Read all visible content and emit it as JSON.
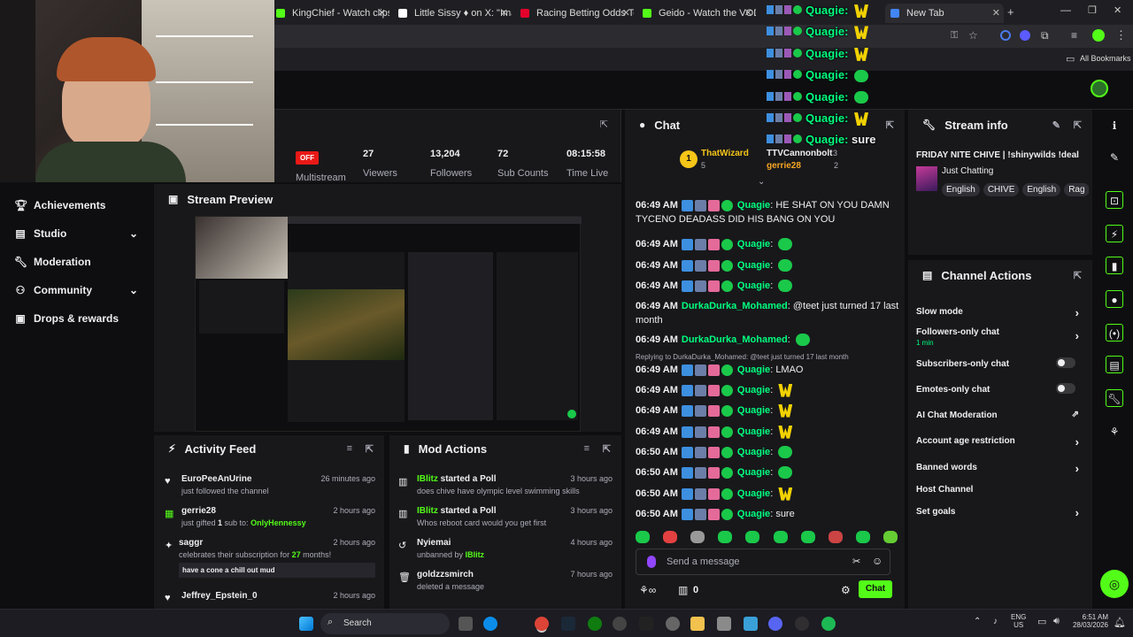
{
  "browser": {
    "tabs": [
      {
        "title": "KingChief - Watch clips o",
        "color": "#53fc18"
      },
      {
        "title": "Little Sissy ♦ on X: \"Imag",
        "color": "#ffffff"
      },
      {
        "title": "Racing Betting Odds Toda",
        "color": "#e4002b"
      },
      {
        "title": "Geido - Watch the VOD o",
        "color": "#53fc18"
      },
      {
        "title": "New Tab",
        "color": "#4285f4"
      }
    ],
    "bookmarks_label": "All Bookmarks"
  },
  "sidebar": {
    "items": [
      {
        "label": "Achievements",
        "icon": "trophy-icon",
        "chevron": false
      },
      {
        "label": "Studio",
        "icon": "studio-icon",
        "chevron": true
      },
      {
        "label": "Moderation",
        "icon": "wrench-icon",
        "chevron": false
      },
      {
        "label": "Community",
        "icon": "community-icon",
        "chevron": true
      },
      {
        "label": "Drops & rewards",
        "icon": "gift-icon",
        "chevron": false
      }
    ]
  },
  "stats": {
    "multistream_badge": "OFF",
    "multistream_label": "Multistream",
    "viewers": "27",
    "viewers_label": "Viewers",
    "followers": "13,204",
    "followers_label": "Followers",
    "subs": "72",
    "subs_label": "Sub Counts",
    "time_live": "08:15:58",
    "time_live_label": "Time Live"
  },
  "preview": {
    "title": "Stream Preview"
  },
  "activity": {
    "title": "Activity Feed",
    "items": [
      {
        "icon": "heart-icon",
        "name": "EuroPeeAnUrine",
        "text": "just followed the channel",
        "time": "26 minutes ago"
      },
      {
        "icon": "gift-icon",
        "name": "gerrie28",
        "text_pre": "just gifted ",
        "count": "1",
        "text_mid": " sub to: ",
        "target": "OnlyHennessy",
        "time": "2 hours ago"
      },
      {
        "icon": "star-icon",
        "name": "saggr",
        "text_pre": "celebrates their subscription for ",
        "count": "27",
        "text_mid": " months!",
        "quote": "have a cone a chill out mud",
        "time": "2 hours ago"
      },
      {
        "icon": "heart-icon",
        "name": "Jeffrey_Epstein_0",
        "text": "",
        "time": "2 hours ago"
      }
    ]
  },
  "modactions": {
    "title": "Mod Actions",
    "items": [
      {
        "icon": "poll-icon",
        "user": "IBlitz",
        "action": " started a Poll",
        "detail": "does chive have olympic level swimming skills",
        "time": "3 hours ago"
      },
      {
        "icon": "poll-icon",
        "user": "IBlitz",
        "action": " started a Poll",
        "detail": "Whos reboot card would you get first",
        "time": "3 hours ago"
      },
      {
        "icon": "unban-icon",
        "user": "Nyiemai",
        "action": "",
        "detail_pre": "unbanned by ",
        "detail_user": "IBlitz",
        "time": "4 hours ago"
      },
      {
        "icon": "trash-icon",
        "user": "goldzzsmirch",
        "action": "",
        "detail": "deleted a message",
        "time": "7 hours ago"
      }
    ]
  },
  "chat": {
    "title": "Chat",
    "leaderboard": [
      {
        "rank": "1",
        "name": "ThatWizard",
        "count": "5"
      },
      {
        "rank": "",
        "name": "TTVCannonbolt",
        "count": "3"
      },
      {
        "rank": "",
        "name": "gerrie28",
        "count": "2"
      }
    ],
    "messages": [
      {
        "time": "",
        "user": "Quagie",
        "text": "HE SHAT ON YOU DAMN TYCENO DEADASS DID HIS BANG ON YOU",
        "badges": true,
        "emote": ""
      },
      {
        "time": "06:49 AM",
        "user": "Quagie",
        "text": "",
        "badges": true,
        "emote": "green"
      },
      {
        "time": "06:49 AM",
        "user": "Quagie",
        "text": "",
        "badges": true,
        "emote": "green"
      },
      {
        "time": "06:49 AM",
        "user": "Quagie",
        "text": "",
        "badges": true,
        "emote": "green"
      },
      {
        "time": "06:49 AM",
        "user": "DurkaDurka_Mohamed",
        "text": "@teet just turned 17 last month",
        "badges": false,
        "emote": ""
      },
      {
        "time": "06:49 AM",
        "user": "DurkaDurka_Mohamed",
        "text": "",
        "badges": false,
        "emote": "green"
      },
      {
        "time": "06:49 AM",
        "user": "Quagie",
        "text": "LMAO",
        "badges": true,
        "emote": "",
        "reply": "Replying to DurkaDurka_Mohamed: @teet just turned 17 last month"
      },
      {
        "time": "06:49 AM",
        "user": "Quagie",
        "text": "",
        "badges": true,
        "emote": "W"
      },
      {
        "time": "06:49 AM",
        "user": "Quagie",
        "text": "",
        "badges": true,
        "emote": "W"
      },
      {
        "time": "06:49 AM",
        "user": "Quagie",
        "text": "",
        "badges": true,
        "emote": "W"
      },
      {
        "time": "06:50 AM",
        "user": "Quagie",
        "text": "",
        "badges": true,
        "emote": "green"
      },
      {
        "time": "06:50 AM",
        "user": "Quagie",
        "text": "",
        "badges": true,
        "emote": "green"
      },
      {
        "time": "06:50 AM",
        "user": "Quagie",
        "text": "",
        "badges": true,
        "emote": "W"
      },
      {
        "time": "06:50 AM",
        "user": "Quagie",
        "text": "sure",
        "badges": true,
        "emote": ""
      }
    ],
    "first_time": "06:49 AM",
    "input_placeholder": "Send a message",
    "points": "0",
    "send_label": "Chat"
  },
  "overlay": [
    {
      "user": "Quagie",
      "text": "",
      "emote": "W"
    },
    {
      "user": "Quagie",
      "text": "",
      "emote": "W"
    },
    {
      "user": "Quagie",
      "text": "",
      "emote": "W"
    },
    {
      "user": "Quagie",
      "text": "",
      "emote": "green"
    },
    {
      "user": "Quagie",
      "text": "",
      "emote": "green"
    },
    {
      "user": "Quagie",
      "text": "",
      "emote": "W"
    },
    {
      "user": "Quagie",
      "text": "sure",
      "emote": ""
    }
  ],
  "streaminfo": {
    "title": "Stream info",
    "stream_title": "FRIDAY NITE CHIVE | !shinywilds !deal",
    "category": "Just Chatting",
    "tags": [
      "English",
      "CHIVE",
      "English",
      "Rag"
    ]
  },
  "channel_actions": {
    "title": "Channel Actions",
    "items": [
      {
        "label": "Slow mode",
        "sub": "",
        "control": "chevron"
      },
      {
        "label": "Followers-only chat",
        "sub": "1 min",
        "control": "chevron"
      },
      {
        "label": "Subscribers-only chat",
        "sub": "",
        "control": "toggle"
      },
      {
        "label": "Emotes-only chat",
        "sub": "",
        "control": "toggle"
      },
      {
        "label": "AI Chat Moderation",
        "sub": "",
        "control": "external"
      },
      {
        "label": "Account age restriction",
        "sub": "",
        "control": "chevron"
      },
      {
        "label": "Banned words",
        "sub": "",
        "control": "chevron"
      },
      {
        "label": "Host Channel",
        "sub": "",
        "control": "none"
      },
      {
        "label": "Set goals",
        "sub": "",
        "control": "chevron"
      }
    ]
  },
  "taskbar": {
    "search_label": "Search",
    "lang": "ENG",
    "region": "US",
    "time": "6:51 AM",
    "date": "28/03/2026"
  },
  "colors": {
    "accent": "#53fc18",
    "chat_name": "#00ff7f",
    "bg": "#0e0e10",
    "panel": "#18181b"
  }
}
